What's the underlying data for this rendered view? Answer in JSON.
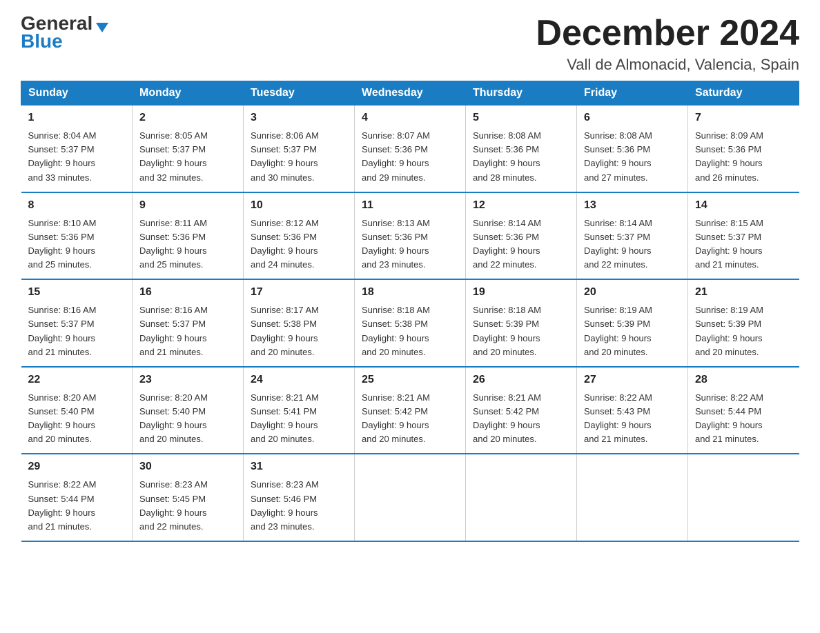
{
  "logo": {
    "text_general": "General",
    "text_blue": "Blue"
  },
  "title": "December 2024",
  "subtitle": "Vall de Almonacid, Valencia, Spain",
  "days_of_week": [
    "Sunday",
    "Monday",
    "Tuesday",
    "Wednesday",
    "Thursday",
    "Friday",
    "Saturday"
  ],
  "weeks": [
    [
      {
        "day": "1",
        "sunrise": "8:04 AM",
        "sunset": "5:37 PM",
        "daylight": "9 hours and 33 minutes."
      },
      {
        "day": "2",
        "sunrise": "8:05 AM",
        "sunset": "5:37 PM",
        "daylight": "9 hours and 32 minutes."
      },
      {
        "day": "3",
        "sunrise": "8:06 AM",
        "sunset": "5:37 PM",
        "daylight": "9 hours and 30 minutes."
      },
      {
        "day": "4",
        "sunrise": "8:07 AM",
        "sunset": "5:36 PM",
        "daylight": "9 hours and 29 minutes."
      },
      {
        "day": "5",
        "sunrise": "8:08 AM",
        "sunset": "5:36 PM",
        "daylight": "9 hours and 28 minutes."
      },
      {
        "day": "6",
        "sunrise": "8:08 AM",
        "sunset": "5:36 PM",
        "daylight": "9 hours and 27 minutes."
      },
      {
        "day": "7",
        "sunrise": "8:09 AM",
        "sunset": "5:36 PM",
        "daylight": "9 hours and 26 minutes."
      }
    ],
    [
      {
        "day": "8",
        "sunrise": "8:10 AM",
        "sunset": "5:36 PM",
        "daylight": "9 hours and 25 minutes."
      },
      {
        "day": "9",
        "sunrise": "8:11 AM",
        "sunset": "5:36 PM",
        "daylight": "9 hours and 25 minutes."
      },
      {
        "day": "10",
        "sunrise": "8:12 AM",
        "sunset": "5:36 PM",
        "daylight": "9 hours and 24 minutes."
      },
      {
        "day": "11",
        "sunrise": "8:13 AM",
        "sunset": "5:36 PM",
        "daylight": "9 hours and 23 minutes."
      },
      {
        "day": "12",
        "sunrise": "8:14 AM",
        "sunset": "5:36 PM",
        "daylight": "9 hours and 22 minutes."
      },
      {
        "day": "13",
        "sunrise": "8:14 AM",
        "sunset": "5:37 PM",
        "daylight": "9 hours and 22 minutes."
      },
      {
        "day": "14",
        "sunrise": "8:15 AM",
        "sunset": "5:37 PM",
        "daylight": "9 hours and 21 minutes."
      }
    ],
    [
      {
        "day": "15",
        "sunrise": "8:16 AM",
        "sunset": "5:37 PM",
        "daylight": "9 hours and 21 minutes."
      },
      {
        "day": "16",
        "sunrise": "8:16 AM",
        "sunset": "5:37 PM",
        "daylight": "9 hours and 21 minutes."
      },
      {
        "day": "17",
        "sunrise": "8:17 AM",
        "sunset": "5:38 PM",
        "daylight": "9 hours and 20 minutes."
      },
      {
        "day": "18",
        "sunrise": "8:18 AM",
        "sunset": "5:38 PM",
        "daylight": "9 hours and 20 minutes."
      },
      {
        "day": "19",
        "sunrise": "8:18 AM",
        "sunset": "5:39 PM",
        "daylight": "9 hours and 20 minutes."
      },
      {
        "day": "20",
        "sunrise": "8:19 AM",
        "sunset": "5:39 PM",
        "daylight": "9 hours and 20 minutes."
      },
      {
        "day": "21",
        "sunrise": "8:19 AM",
        "sunset": "5:39 PM",
        "daylight": "9 hours and 20 minutes."
      }
    ],
    [
      {
        "day": "22",
        "sunrise": "8:20 AM",
        "sunset": "5:40 PM",
        "daylight": "9 hours and 20 minutes."
      },
      {
        "day": "23",
        "sunrise": "8:20 AM",
        "sunset": "5:40 PM",
        "daylight": "9 hours and 20 minutes."
      },
      {
        "day": "24",
        "sunrise": "8:21 AM",
        "sunset": "5:41 PM",
        "daylight": "9 hours and 20 minutes."
      },
      {
        "day": "25",
        "sunrise": "8:21 AM",
        "sunset": "5:42 PM",
        "daylight": "9 hours and 20 minutes."
      },
      {
        "day": "26",
        "sunrise": "8:21 AM",
        "sunset": "5:42 PM",
        "daylight": "9 hours and 20 minutes."
      },
      {
        "day": "27",
        "sunrise": "8:22 AM",
        "sunset": "5:43 PM",
        "daylight": "9 hours and 21 minutes."
      },
      {
        "day": "28",
        "sunrise": "8:22 AM",
        "sunset": "5:44 PM",
        "daylight": "9 hours and 21 minutes."
      }
    ],
    [
      {
        "day": "29",
        "sunrise": "8:22 AM",
        "sunset": "5:44 PM",
        "daylight": "9 hours and 21 minutes."
      },
      {
        "day": "30",
        "sunrise": "8:23 AM",
        "sunset": "5:45 PM",
        "daylight": "9 hours and 22 minutes."
      },
      {
        "day": "31",
        "sunrise": "8:23 AM",
        "sunset": "5:46 PM",
        "daylight": "9 hours and 23 minutes."
      },
      null,
      null,
      null,
      null
    ]
  ],
  "labels": {
    "sunrise": "Sunrise:",
    "sunset": "Sunset:",
    "daylight": "Daylight:"
  }
}
